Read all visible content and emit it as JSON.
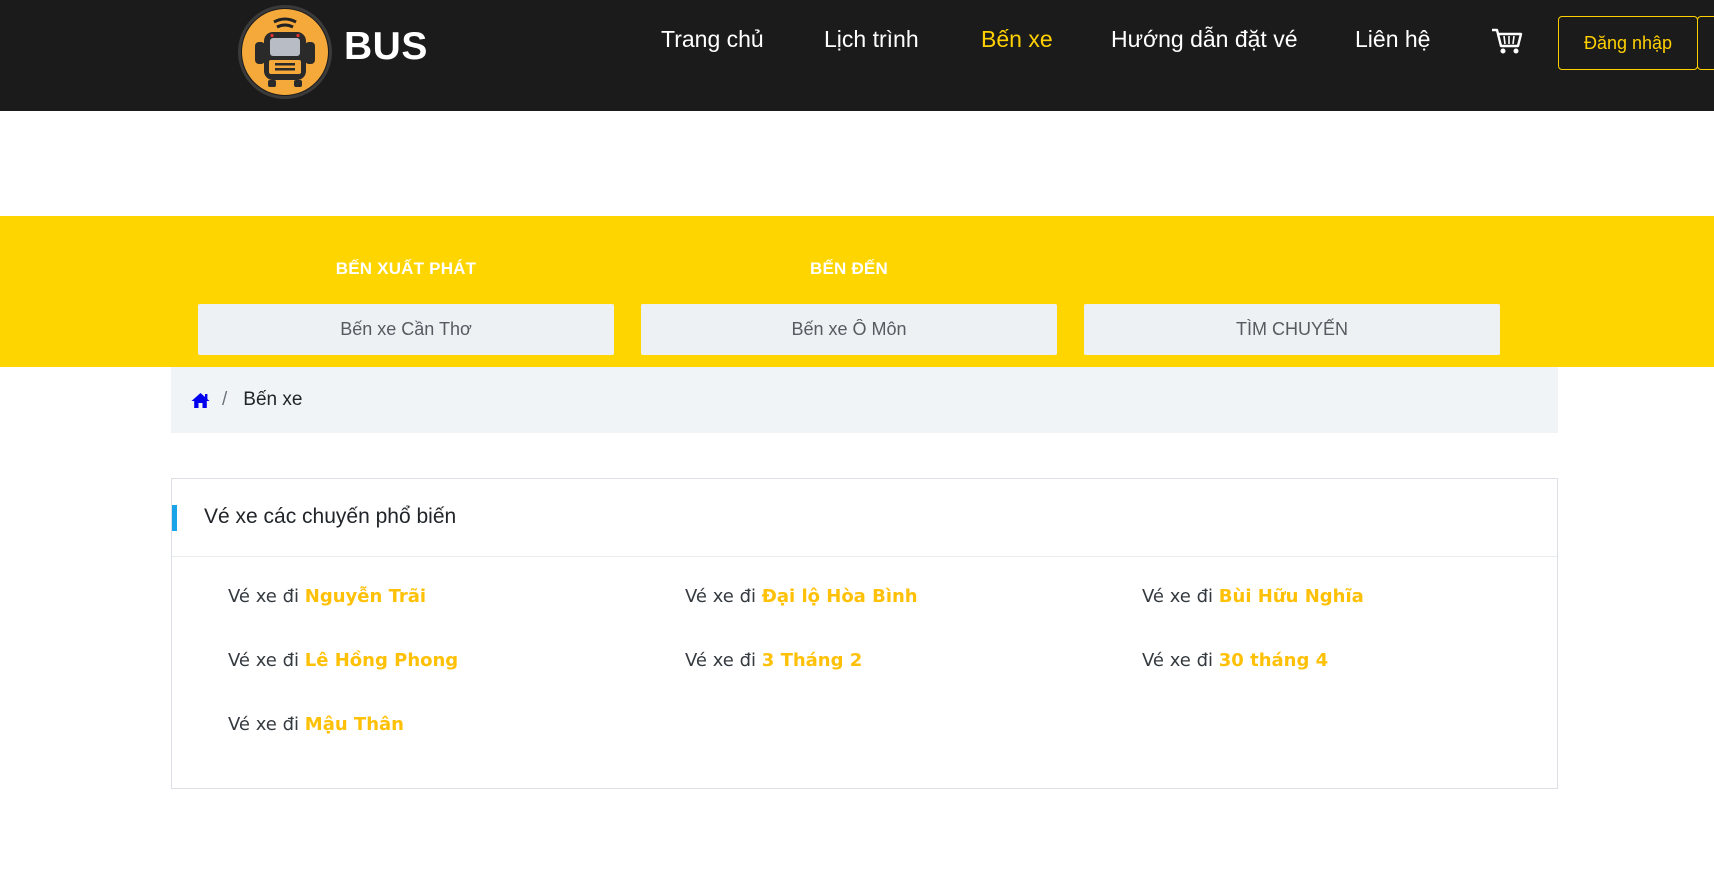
{
  "header": {
    "brand": "BUS",
    "nav": [
      {
        "label": "Trang chủ",
        "active": false
      },
      {
        "label": "Lịch trình",
        "active": false
      },
      {
        "label": "Bến xe",
        "active": true
      },
      {
        "label": "Hướng dẫn đặt vé",
        "active": false
      },
      {
        "label": "Liên hệ",
        "active": false
      }
    ],
    "cart_icon": "cart-icon",
    "login_label": "Đăng nhập"
  },
  "search": {
    "from_label": "BẾN XUẤT PHÁT",
    "from_value": "Bến xe Cần Thơ",
    "to_label": "BẾN ĐẾN",
    "to_value": "Bến xe Ô Môn",
    "button_label": "TÌM CHUYẾN"
  },
  "breadcrumb": {
    "home_icon": "home-icon",
    "separator": "/",
    "current": "Bến xe"
  },
  "popular": {
    "title": "Vé xe các chuyến phổ biến",
    "prefix": "Vé xe đi",
    "routes": [
      "Nguyễn Trãi",
      "Đại lộ Hòa Bình",
      "Bùi Hữu Nghĩa",
      "Lê Hồng Phong",
      "3 Tháng 2",
      "30 tháng 4",
      "Mậu Thân"
    ]
  },
  "colors": {
    "header_bg": "#1b1b1b",
    "accent_yellow": "#ffd500",
    "active_nav": "#ffd000",
    "route_highlight": "#ffc107",
    "card_accent": "#1aa3e8",
    "home_icon": "#0000ee"
  }
}
